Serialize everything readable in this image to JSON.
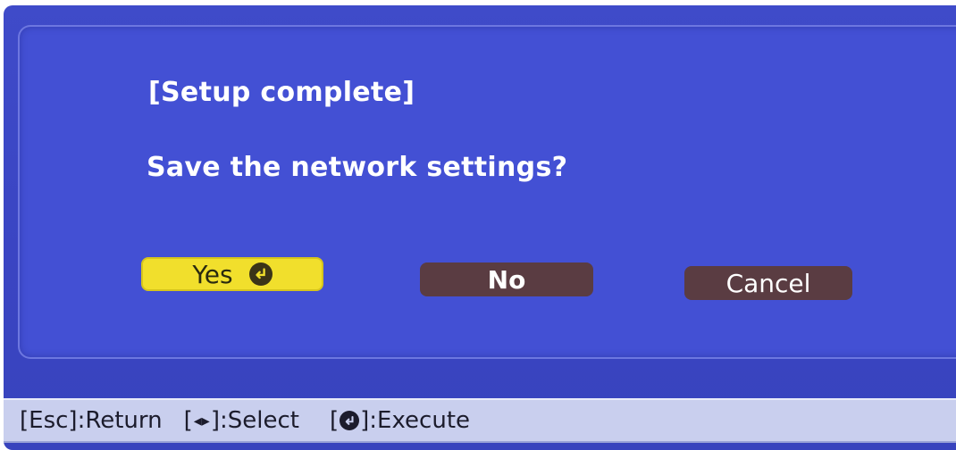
{
  "dialog": {
    "title": "[Setup complete]",
    "message": "Save the network settings?",
    "buttons": {
      "yes": {
        "label": "Yes",
        "selected": true
      },
      "no": {
        "label": "No",
        "selected": false
      },
      "cancel": {
        "label": "Cancel",
        "selected": false
      }
    }
  },
  "help_bar": {
    "esc": {
      "key_open": "[Esc]",
      "action": " :Return"
    },
    "select": {
      "key_open": "[",
      "key_close": "]",
      "action": ":Select"
    },
    "execute": {
      "key_open": "[",
      "key_close": "]",
      "action": ":Execute"
    }
  },
  "icons": {
    "yes_button_icon": "enter-icon",
    "select_icon": "left-right-arrows-icon",
    "execute_icon": "enter-icon"
  },
  "colors": {
    "background": "#3f4bc9",
    "selected_button": "#f1df2c",
    "unselected_button": "#5a3c42",
    "help_bar": "#c9cfee",
    "text": "#ffffff"
  }
}
